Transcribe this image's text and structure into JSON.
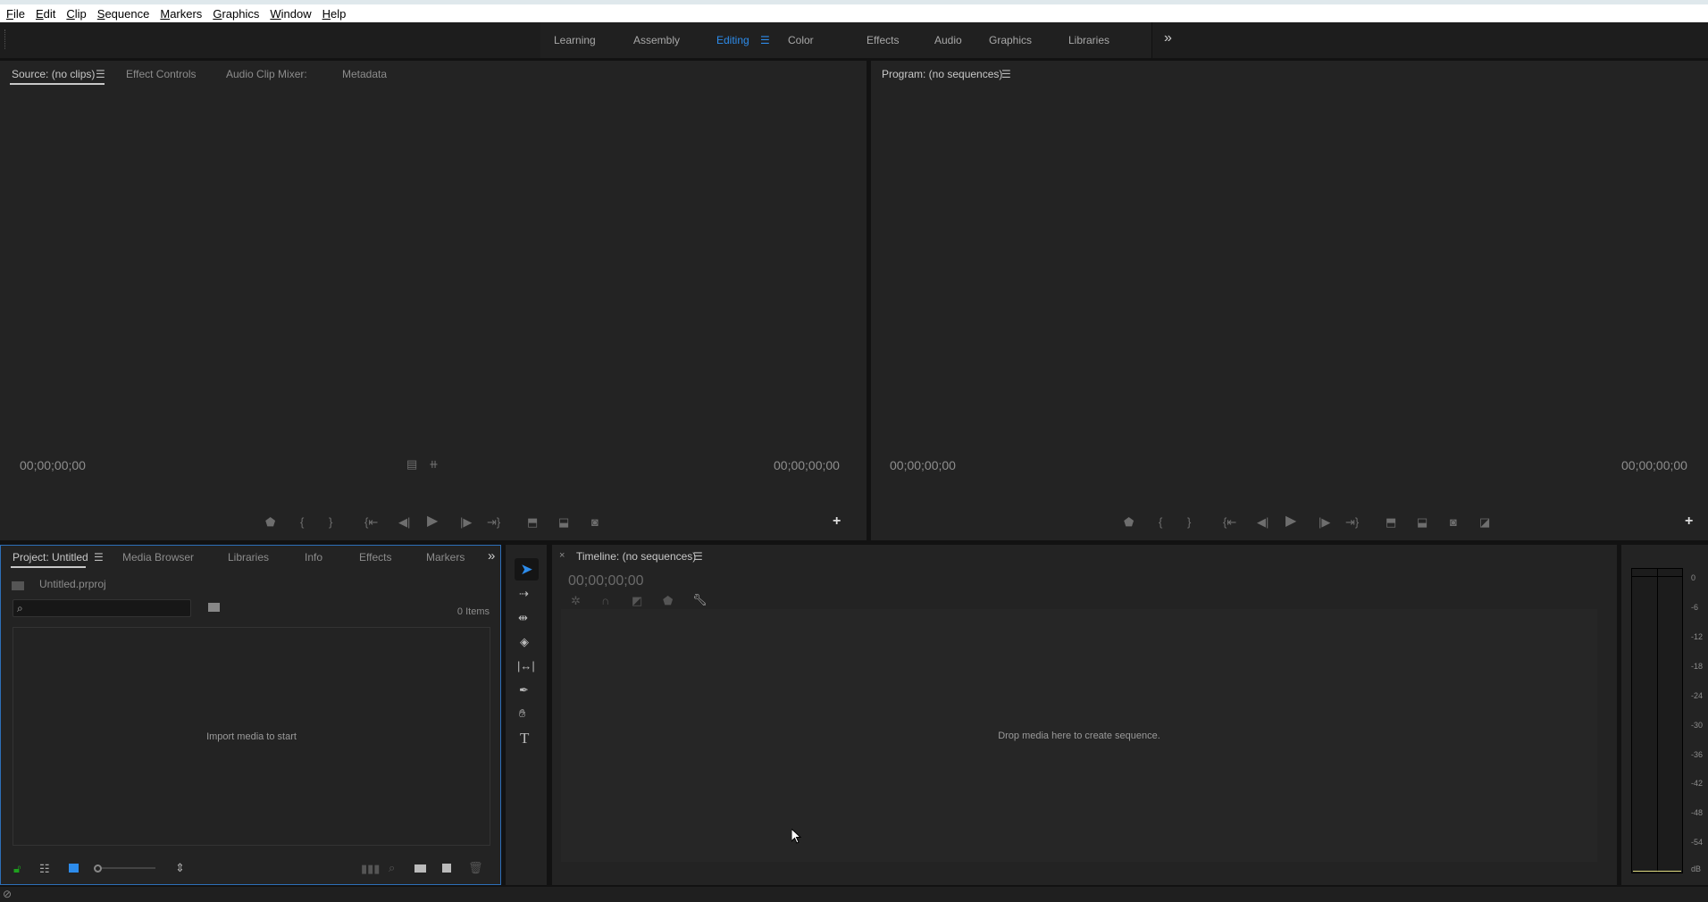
{
  "menu": [
    "File",
    "Edit",
    "Clip",
    "Sequence",
    "Markers",
    "Graphics",
    "Window",
    "Help"
  ],
  "workspaces": {
    "items": [
      "Learning",
      "Assembly",
      "Editing",
      "Color",
      "Effects",
      "Audio",
      "Graphics",
      "Libraries"
    ],
    "active": "Editing",
    "overflow": "»"
  },
  "source": {
    "tabs": [
      "Source: (no clips)",
      "Effect Controls",
      "Audio Clip Mixer:",
      "Metadata"
    ],
    "timecode_left": "00;00;00;00",
    "timecode_right": "00;00;00;00"
  },
  "program": {
    "title": "Program: (no sequences)",
    "timecode_left": "00;00;00;00",
    "timecode_right": "00;00;00;00"
  },
  "project": {
    "tabs": [
      "Project: Untitled",
      "Media Browser",
      "Libraries",
      "Info",
      "Effects",
      "Markers"
    ],
    "overflow": "»",
    "file": "Untitled.prproj",
    "search_placeholder": "",
    "items_count": "0 Items",
    "empty_text": "Import media to start"
  },
  "timeline": {
    "close": "×",
    "title": "Timeline: (no sequences)",
    "timecode": "00;00;00;00",
    "empty_text": "Drop media here to create sequence."
  },
  "meter": {
    "scale": [
      "0",
      "-6",
      "-12",
      "-18",
      "-24",
      "-30",
      "-36",
      "-42",
      "-48",
      "-54",
      "dB"
    ]
  },
  "colors": {
    "accent": "#2d8ceb",
    "panel": "#232323",
    "focus_border": "#2d6fb8",
    "unlock_green": "#1ea01e",
    "meter_peak": "#d8d47a"
  }
}
